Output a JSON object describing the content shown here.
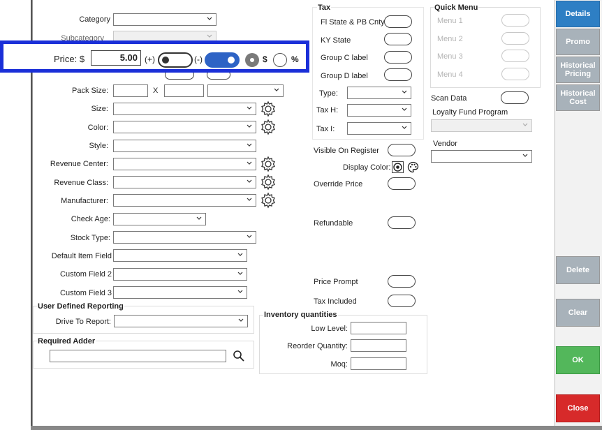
{
  "colors": {
    "details": "#2e7fc4",
    "gray_btn": "#a8b2ba",
    "ok": "#53b75b",
    "close": "#d72a2a",
    "highlight": "#1a2fd8",
    "toggle_on": "#2e63c5"
  },
  "main": {
    "category_label": "Category",
    "subcategory_label": "Subcategory",
    "pack_size_label": "Pack Size:",
    "pack_x": "X",
    "size_label": "Size:",
    "color_label": "Color:",
    "style_label": "Style:",
    "revenue_center_label": "Revenue Center:",
    "revenue_class_label": "Revenue Class:",
    "manufacturer_label": "Manufacturer:",
    "check_age_label": "Check Age:",
    "stock_type_label": "Stock Type:",
    "default_item_field_label": "Default Item Field",
    "custom_field_2_label": "Custom Field 2",
    "custom_field_3_label": "Custom Field 3"
  },
  "price": {
    "label": "Price: $",
    "value": "5.00",
    "plus_label": "(+)",
    "minus_label": "(-)",
    "dollar_label": "$",
    "percent_label": "%"
  },
  "user_defined": {
    "title": "User Defined Reporting",
    "drive_label": "Drive To Report:"
  },
  "required_adder": {
    "title": "Required Adder"
  },
  "tax": {
    "title": "Tax",
    "fl_label": "Fl State & PB Cnty",
    "ky_label": "KY State",
    "c_label": "Group C label",
    "d_label": "Group D label",
    "type_label": "Type:",
    "taxh_label": "Tax H:",
    "taxi_label": "Tax I:"
  },
  "quick_menu": {
    "title": "Quick Menu",
    "items": [
      "Menu 1",
      "Menu 2",
      "Menu 3",
      "Menu 4"
    ]
  },
  "mid": {
    "scan_data_label": "Scan Data",
    "loyalty_label": "Loyalty Fund Program",
    "vendor_label": "Vendor",
    "visible_label": "Visible On Register",
    "display_color_label": "Display Color:",
    "override_label": "Override Price",
    "refundable_label": "Refundable",
    "price_prompt_label": "Price Prompt",
    "tax_included_label": "Tax Included"
  },
  "inventory": {
    "title": "Inventory quantities",
    "low_label": "Low Level:",
    "reorder_label": "Reorder Quantity:",
    "moq_label": "Moq:"
  },
  "sidebar": {
    "details": "Details",
    "promo": "Promo",
    "historical_pricing": "Historical Pricing",
    "historical_cost": "Historical Cost",
    "delete": "Delete",
    "clear": "Clear",
    "ok": "OK",
    "close": "Close"
  }
}
